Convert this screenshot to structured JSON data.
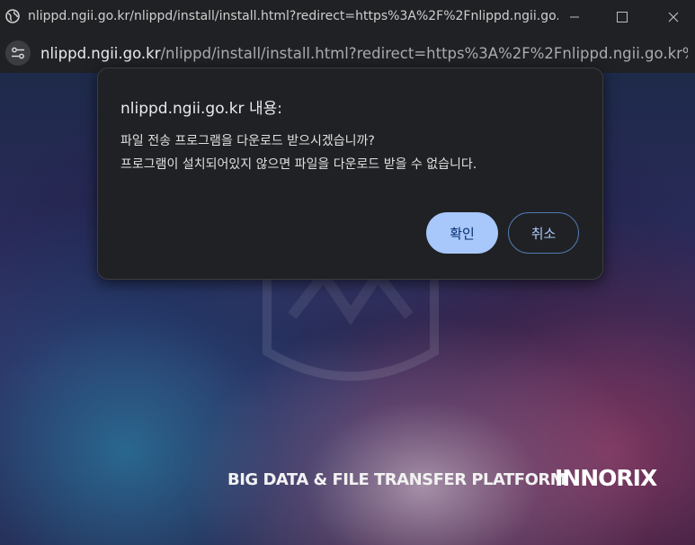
{
  "window": {
    "title": "nlippd.ngii.go.kr/nlippd/install/install.html?redirect=https%3A%2F%2Fnlippd.ngii.go...",
    "favicon_icon": "globe-icon",
    "controls": [
      "minimize-icon",
      "maximize-icon",
      "close-icon"
    ]
  },
  "addressbar": {
    "site_info_icon": "tune-icon",
    "url_host": "nlippd.ngii.go.kr",
    "url_path": "/nlippd/install/install.html?redirect=https%3A%2F%2Fnlippd.ngii.go.kr%..."
  },
  "dialog": {
    "title": "nlippd.ngii.go.kr 내용:",
    "message_line1": "파일 전송 프로그램을 다운로드 받으시겠습니까?",
    "message_line2": "프로그램이 설치되어있지 않으면 파일을 다운로드 받을 수 없습니다.",
    "ok_label": "확인",
    "cancel_label": "취소"
  },
  "page": {
    "tagline": "BIG DATA & FILE TRANSFER PLATFORM",
    "brand": "INNORIX"
  },
  "colors": {
    "chrome_bg": "#202124",
    "ok_button": "#a8c7fa",
    "cancel_border": "#4f7ab5"
  }
}
